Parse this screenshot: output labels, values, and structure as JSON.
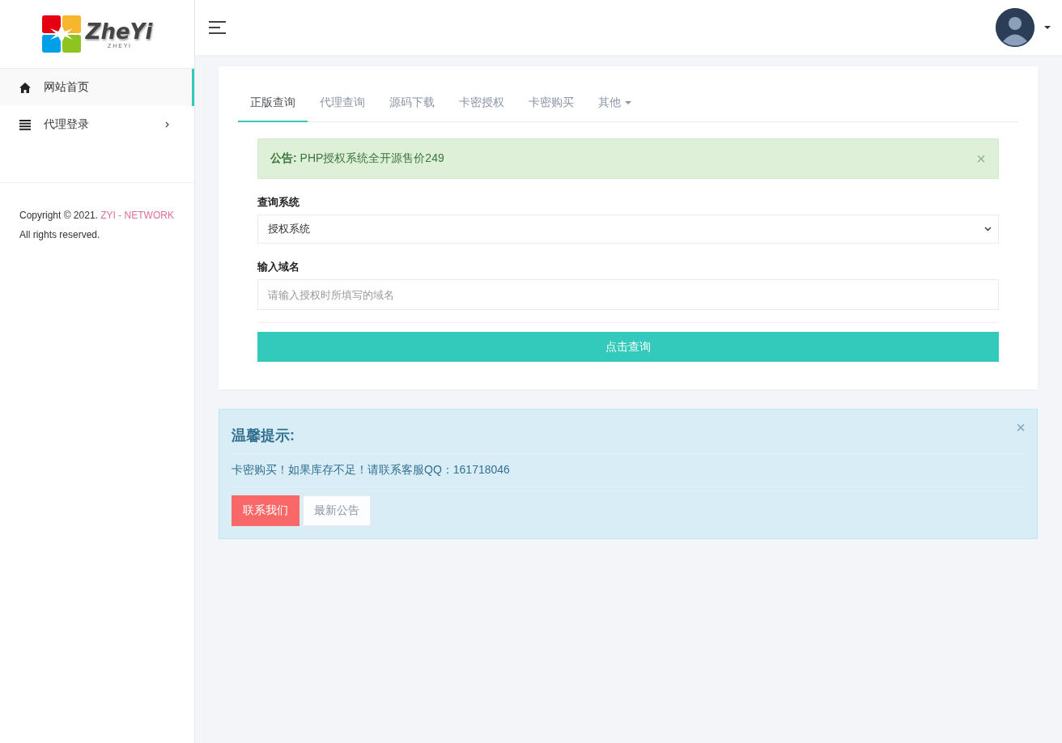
{
  "sidebar": {
    "logo": {
      "title": "ZheYi",
      "subtitle": "Z H E Y I"
    },
    "nav": [
      {
        "label": "网站首页",
        "selected": true,
        "has_submenu": false
      },
      {
        "label": "代理登录",
        "selected": false,
        "has_submenu": true
      }
    ],
    "copyright": {
      "before": "Copyright © 2021. ",
      "link": "ZYI - NETWORK",
      "after": " All rights reserved."
    }
  },
  "tabs": [
    {
      "label": "正版查询",
      "selected": true,
      "dropdown": false
    },
    {
      "label": "代理查询",
      "selected": false,
      "dropdown": false
    },
    {
      "label": "源码下载",
      "selected": false,
      "dropdown": false
    },
    {
      "label": "卡密授权",
      "selected": false,
      "dropdown": false
    },
    {
      "label": "卡密购买",
      "selected": false,
      "dropdown": false
    },
    {
      "label": "其他",
      "selected": false,
      "dropdown": true
    }
  ],
  "notice": {
    "text": "**公告:** PHP授权系统全开源售价249",
    "close": "×"
  },
  "form": {
    "system": {
      "label": "查询系统",
      "value": "授权系统"
    },
    "domain": {
      "label": "输入域名",
      "placeholder": "请输入授权时所填写的域名"
    },
    "submit": "点击查询"
  },
  "tips": {
    "title": "温馨提示:",
    "text": "卡密购买！如果库存不足！请联系客服QQ：161718046",
    "close": "×",
    "buttons": [
      {
        "label": "联系我们",
        "kind": "primary"
      },
      {
        "label": "最新公告",
        "kind": "default"
      }
    ]
  }
}
